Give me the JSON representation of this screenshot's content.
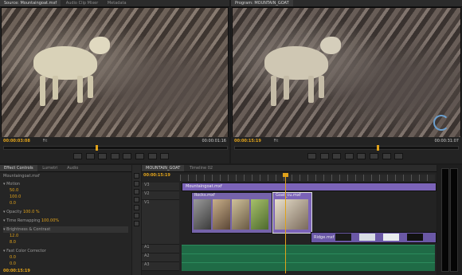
{
  "source_monitor": {
    "tabs": [
      "Source: Mountaingoat.mxf",
      "Audio Clip Mixer",
      "Metadata"
    ],
    "timecode_in": "00:00:03:08",
    "fit": "Fit",
    "timecode_out": "00:00:01:16"
  },
  "program_monitor": {
    "tab": "Program: MOUNTAIN_GOAT",
    "timecode_in": "00:00:15:19",
    "fit": "Fit",
    "timecode_out": "00:00:31:07"
  },
  "effect_controls": {
    "tabs": [
      "Effect Controls",
      "Lumetri",
      "Audio"
    ],
    "clip": "Mountaingoat.mxf",
    "sections": [
      {
        "label": "Motion",
        "values": [
          "50.0",
          "100.0",
          "0.0"
        ]
      },
      {
        "label": "Opacity",
        "values": [
          "100.0 %"
        ]
      },
      {
        "label": "Time Remapping",
        "values": [
          "100.00%"
        ]
      },
      {
        "label": "Brightness & Contrast",
        "values": [
          "12.0",
          "8.0"
        ]
      },
      {
        "label": "Fast Color Corrector",
        "values": [
          "0.0",
          "0.0",
          "0.0"
        ]
      }
    ],
    "timecode": "00:00:15:19"
  },
  "timeline": {
    "tabs": [
      "MOUNTAIN_GOAT",
      "Timeline 02"
    ],
    "timecode": "00:00:15:19",
    "tracks": [
      "V3",
      "V2",
      "V1",
      "A1",
      "A2",
      "A3"
    ],
    "clips": [
      "Mountaingoat.mxf",
      "Rocks.mxf",
      "Goat_cu.mxf",
      "Ridge.mxf"
    ]
  }
}
